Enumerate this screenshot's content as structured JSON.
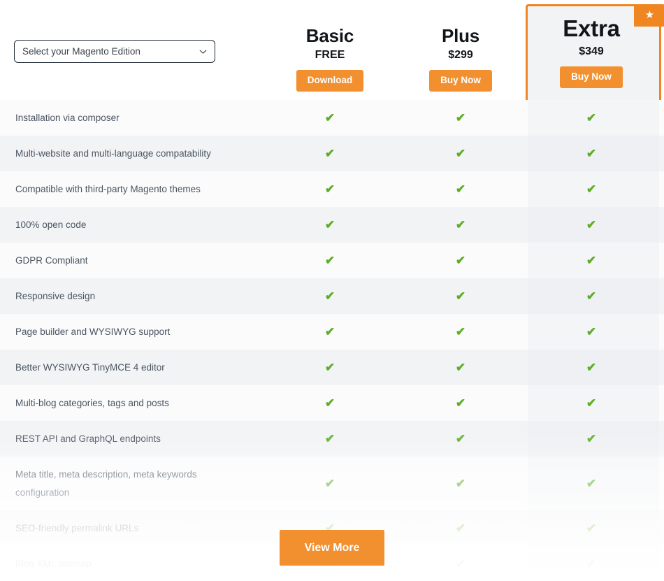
{
  "selector": {
    "value": "Select your Magento Edition",
    "placeholder": "Select your Magento Edition",
    "chevron_icon": "chevron-down-icon",
    "options": [
      "Select your Magento Edition"
    ]
  },
  "plans": [
    {
      "name": "Basic",
      "price": "FREE",
      "cta_label": "Download",
      "featured": false
    },
    {
      "name": "Plus",
      "price": "$299",
      "cta_label": "Buy Now",
      "featured": false
    },
    {
      "name": "Extra",
      "price": "$349",
      "cta_label": "Buy Now",
      "featured": true,
      "badge_icon": "star-icon",
      "badge_glyph": "★"
    }
  ],
  "features": [
    {
      "label": "Installation via composer",
      "basic": "✔",
      "plus": "✔",
      "extra": "✔"
    },
    {
      "label": "Multi-website and multi-language compatability",
      "basic": "✔",
      "plus": "✔",
      "extra": "✔"
    },
    {
      "label": "Compatible with third-party Magento themes",
      "basic": "✔",
      "plus": "✔",
      "extra": "✔"
    },
    {
      "label": "100% open code",
      "basic": "✔",
      "plus": "✔",
      "extra": "✔"
    },
    {
      "label": "GDPR Compliant",
      "basic": "✔",
      "plus": "✔",
      "extra": "✔"
    },
    {
      "label": "Responsive design",
      "basic": "✔",
      "plus": "✔",
      "extra": "✔"
    },
    {
      "label": "Page builder and WYSIWYG support",
      "basic": "✔",
      "plus": "✔",
      "extra": "✔"
    },
    {
      "label": "Better WYSIWYG TinyMCE 4 editor",
      "basic": "✔",
      "plus": "✔",
      "extra": "✔"
    },
    {
      "label": "Multi-blog categories, tags and posts",
      "basic": "✔",
      "plus": "✔",
      "extra": "✔"
    },
    {
      "label": "REST API and GraphQL endpoints",
      "basic": "✔",
      "plus": "✔",
      "extra": "✔"
    },
    {
      "label": "Meta title, meta description, meta keywords configuration",
      "basic": "✔",
      "plus": "✔",
      "extra": "✔",
      "tall": true
    },
    {
      "label": "SEO-friendly permalink URLs",
      "basic": "✔",
      "plus": "✔",
      "extra": "✔"
    },
    {
      "label": "Blog XML sitemap",
      "basic": "✔",
      "plus": "✔",
      "extra": "✔"
    }
  ],
  "view_more": {
    "label": "View More"
  },
  "colors": {
    "accent_orange": "#f2902f",
    "featured_border": "#f08622",
    "check_green": "#5ead27",
    "row_odd": "#fbfbfc",
    "row_even": "#f2f3f5",
    "text_primary": "#12161b",
    "text_body": "#4a5561"
  }
}
